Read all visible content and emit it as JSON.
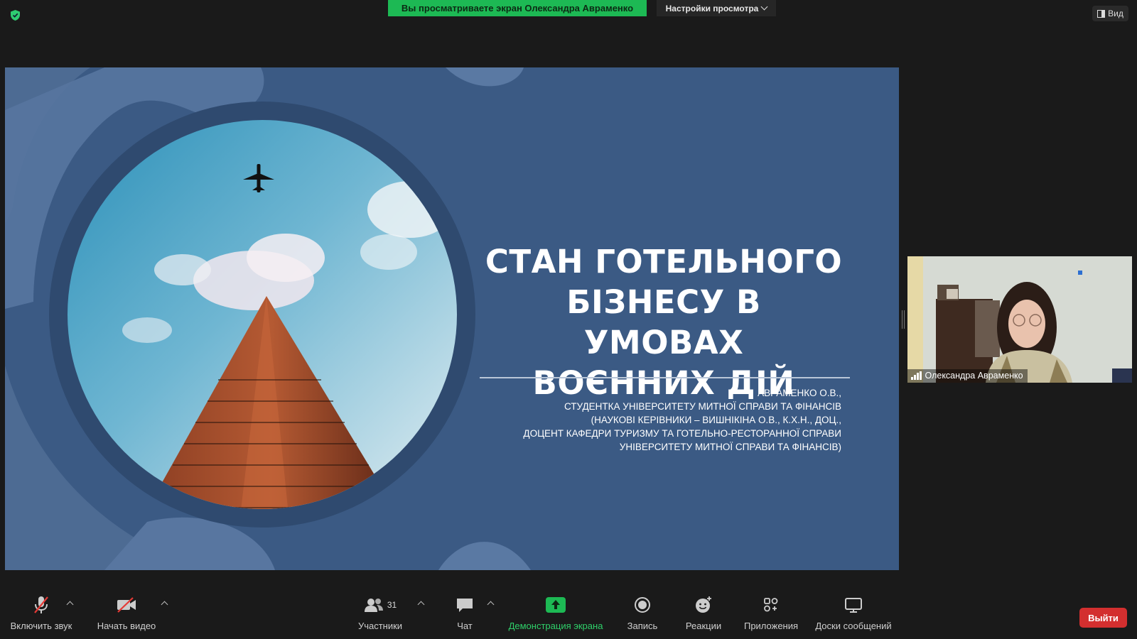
{
  "top_bar": {
    "sharing_banner": "Вы просматриваете экран Олександра Авраменко",
    "view_settings_label": "Настройки просмотра",
    "view_button_label": "Вид"
  },
  "slide": {
    "title_lines": [
      "СТАН ГОТЕЛЬНОГО",
      "БІЗНЕСУ В УМОВАХ",
      "ВОЄННИХ ДІЙ"
    ],
    "author_lines": [
      "АВРАМЕНКО О.В.,",
      "СТУДЕНТКА УНІВЕРСИТЕТУ МИТНОЇ СПРАВИ ТА ФІНАНСІВ",
      "(НАУКОВІ КЕРІВНИКИ – ВИШНІКІНА О.В., К.Х.Н., ДОЦ.,",
      "ДОЦЕНТ КАФЕДРИ ТУРИЗМУ ТА ГОТЕЛЬНО-РЕСТОРАННОЇ СПРАВИ",
      "УНІВЕРСИТЕТУ МИТНОЇ СПРАВИ ТА ФІНАНСІВ)"
    ]
  },
  "participant_video": {
    "name": "Олександра Авраменко"
  },
  "toolbar": {
    "unmute": "Включить звук",
    "start_video": "Начать видео",
    "participants": "Участники",
    "participants_count": "31",
    "chat": "Чат",
    "share_screen": "Демонстрация экрана",
    "record": "Запись",
    "reactions": "Реакции",
    "apps": "Приложения",
    "whiteboards": "Доски сообщений",
    "leave": "Выйти"
  },
  "colors": {
    "share_green": "#1db954",
    "slide_blue": "#3b5a84",
    "leave_red": "#d32f2f"
  }
}
